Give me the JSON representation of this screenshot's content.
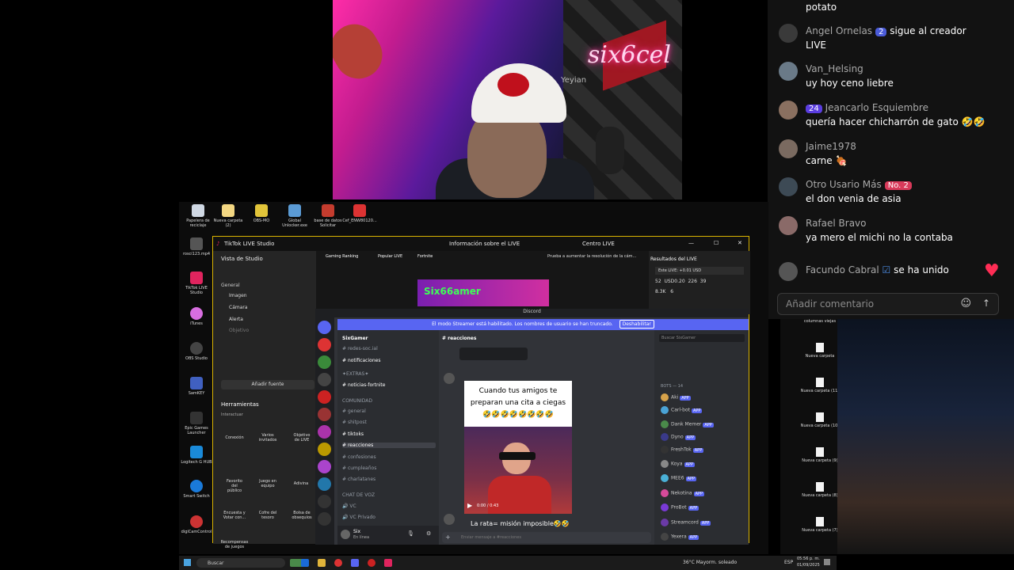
{
  "chat": {
    "partial_message": "potato",
    "messages": [
      {
        "name": "Angel Ornelas",
        "badge": "2",
        "badge_color": "#4a5bd9",
        "message": "sigue al creador",
        "message2": "LIVE"
      },
      {
        "name": "Van_Helsing",
        "message": "uy hoy ceno liebre"
      },
      {
        "name": "Jeancarlo Esquiembre",
        "badge": "24",
        "badge_color": "#5a3de0",
        "message": "quería hacer chicharrón de gato 🤣🤣"
      },
      {
        "name": "Jaime1978",
        "message": "carne 🍖"
      },
      {
        "name": "Otro Usario Más",
        "badge": "No. 2",
        "badge_color": "#d83a5a",
        "message": "el don venia de asia"
      },
      {
        "name": "Rafael Bravo",
        "message": "ya mero el michi no la contaba"
      },
      {
        "name": "Facundo Cabral",
        "message": "se ha unido"
      }
    ],
    "input_placeholder": "Añadir comentario"
  },
  "webcam": {
    "neon_text": "six6cel",
    "chair_text": "Yeyian"
  },
  "desktop_icons": [
    {
      "label": "Papelera de reciclaje",
      "color": "#cfd8e3"
    },
    {
      "label": "Nueva carpeta (2)",
      "color": "#f3d782"
    },
    {
      "label": "OBS-MO",
      "color": "#e2c53a"
    },
    {
      "label": "Global Unlocker.exe",
      "color": "#5b9bd5"
    },
    {
      "label": "base de datos Solicitar",
      "color": "#c43c2e"
    },
    {
      "label": "Cef_ENW80120...",
      "color": "#d33"
    }
  ],
  "desktop_left_icons": [
    {
      "label": "rosci123.mp4",
      "color": "#555"
    },
    {
      "label": "TikTok LIVE Studio",
      "color": "#e0245e"
    },
    {
      "label": "iTunes",
      "color": "#d86ee0"
    },
    {
      "label": "OBS Studio",
      "color": "#444"
    },
    {
      "label": "SamKEY",
      "color": "#4060c0"
    },
    {
      "label": "Epic Games Launcher",
      "color": "#333"
    },
    {
      "label": "Logitech G HUB",
      "color": "#1a8ad9"
    },
    {
      "label": "Smart Switch",
      "color": "#1a7ad9"
    },
    {
      "label": "digiCamControl",
      "color": "#c33"
    }
  ],
  "studio": {
    "title": "TikTok LIVE Studio",
    "center_title": "Información sobre el LIVE",
    "centro_live": "Centro LIVE",
    "scene_menu": "Vista de Studio",
    "general": "General",
    "sources": [
      "Imagen",
      "Cámara",
      "Alerta",
      "Objetivo"
    ],
    "add_source": "Añadir fuente",
    "tools_title": "Herramientas",
    "interact": "Interactuar",
    "tools": [
      "Conexión",
      "Varios invitados",
      "Objetivo de LIVE",
      "Favorito del público",
      "Juego en equipo",
      "Adivina",
      "Encuesta y Votar con...",
      "Cofre del tesoro",
      "Bolsa de obsequios",
      "Recompensas de juegos"
    ],
    "tabs": [
      "Gaming Ranking",
      "Popular LIVE",
      "Fortnite"
    ],
    "hint": "Prueba a aumentar la resolución de la cám...",
    "results_title": "Resultados del LIVE",
    "results_sub": "Este LIVE: +0.01 USD",
    "stats": [
      "52",
      "USD0.20",
      "226",
      "39",
      "8.3K",
      "6"
    ],
    "banner_text": "Six66amer"
  },
  "discord": {
    "window_title": "Discord",
    "banner": "El modo Streamer está habilitado. Los nombres de usuario se han truncado.",
    "banner_button": "Deshabilitar",
    "server_name": "SixGamer",
    "channels": [
      {
        "label": "redes-soc.ial",
        "active": false
      },
      {
        "label": "notificaciones",
        "active": true
      },
      {
        "label": "✦EXTRAS✦",
        "active": false
      },
      {
        "label": "noticias-fortnite",
        "active": true
      },
      {
        "label": "COMUNIDAD",
        "active": false
      },
      {
        "label": "general",
        "active": false
      },
      {
        "label": "shitpost",
        "active": false
      },
      {
        "label": "tiktoks",
        "active": true
      },
      {
        "label": "reacciones",
        "active": true
      },
      {
        "label": "confesiones",
        "active": false
      },
      {
        "label": "cumpleaños",
        "active": false
      },
      {
        "label": "charlatanes",
        "active": false
      },
      {
        "label": "CHAT DE VOZ",
        "active": false
      },
      {
        "label": "VC",
        "active": false
      },
      {
        "label": "VC Privado",
        "active": false
      }
    ],
    "user_name": "Six",
    "user_status": "En línea",
    "channel_header": "reacciones",
    "search_placeholder": "Buscar SixGamer",
    "video_caption": "Cuando tus amigos te preparan una cita a ciegas",
    "video_emojis": "🤣🤣🤣🤣🤣🤣🤣🤣",
    "video_time": "0:00 / 0:43",
    "next_message": "La rata= misión imposible🤣🤣",
    "composer_placeholder": "Enviar mensaje a #reacciones",
    "members_header": "BOTS — 14",
    "members": [
      "Aki",
      "Carl-bot",
      "Dank Memer",
      "Dyno",
      "FreshTok",
      "Koya",
      "MEE6",
      "Nekotina",
      "ProBot",
      "Streamcord",
      "Yexera"
    ]
  },
  "right_folders": [
    {
      "label": "columnas viejas"
    },
    {
      "label": "Nueva carpeta"
    },
    {
      "label": "Nueva carpeta (11)"
    },
    {
      "label": "Nueva carpeta (10)"
    },
    {
      "label": "Nueva carpeta (9)"
    },
    {
      "label": "Nueva carpeta (8)"
    },
    {
      "label": "Nueva carpeta (7)"
    }
  ],
  "taskbar": {
    "search_label": "Buscar",
    "weather": "36°C  Mayorm. soleado",
    "lang": "ESP",
    "time": "05:56 p. m.",
    "date": "01/09/2025"
  }
}
